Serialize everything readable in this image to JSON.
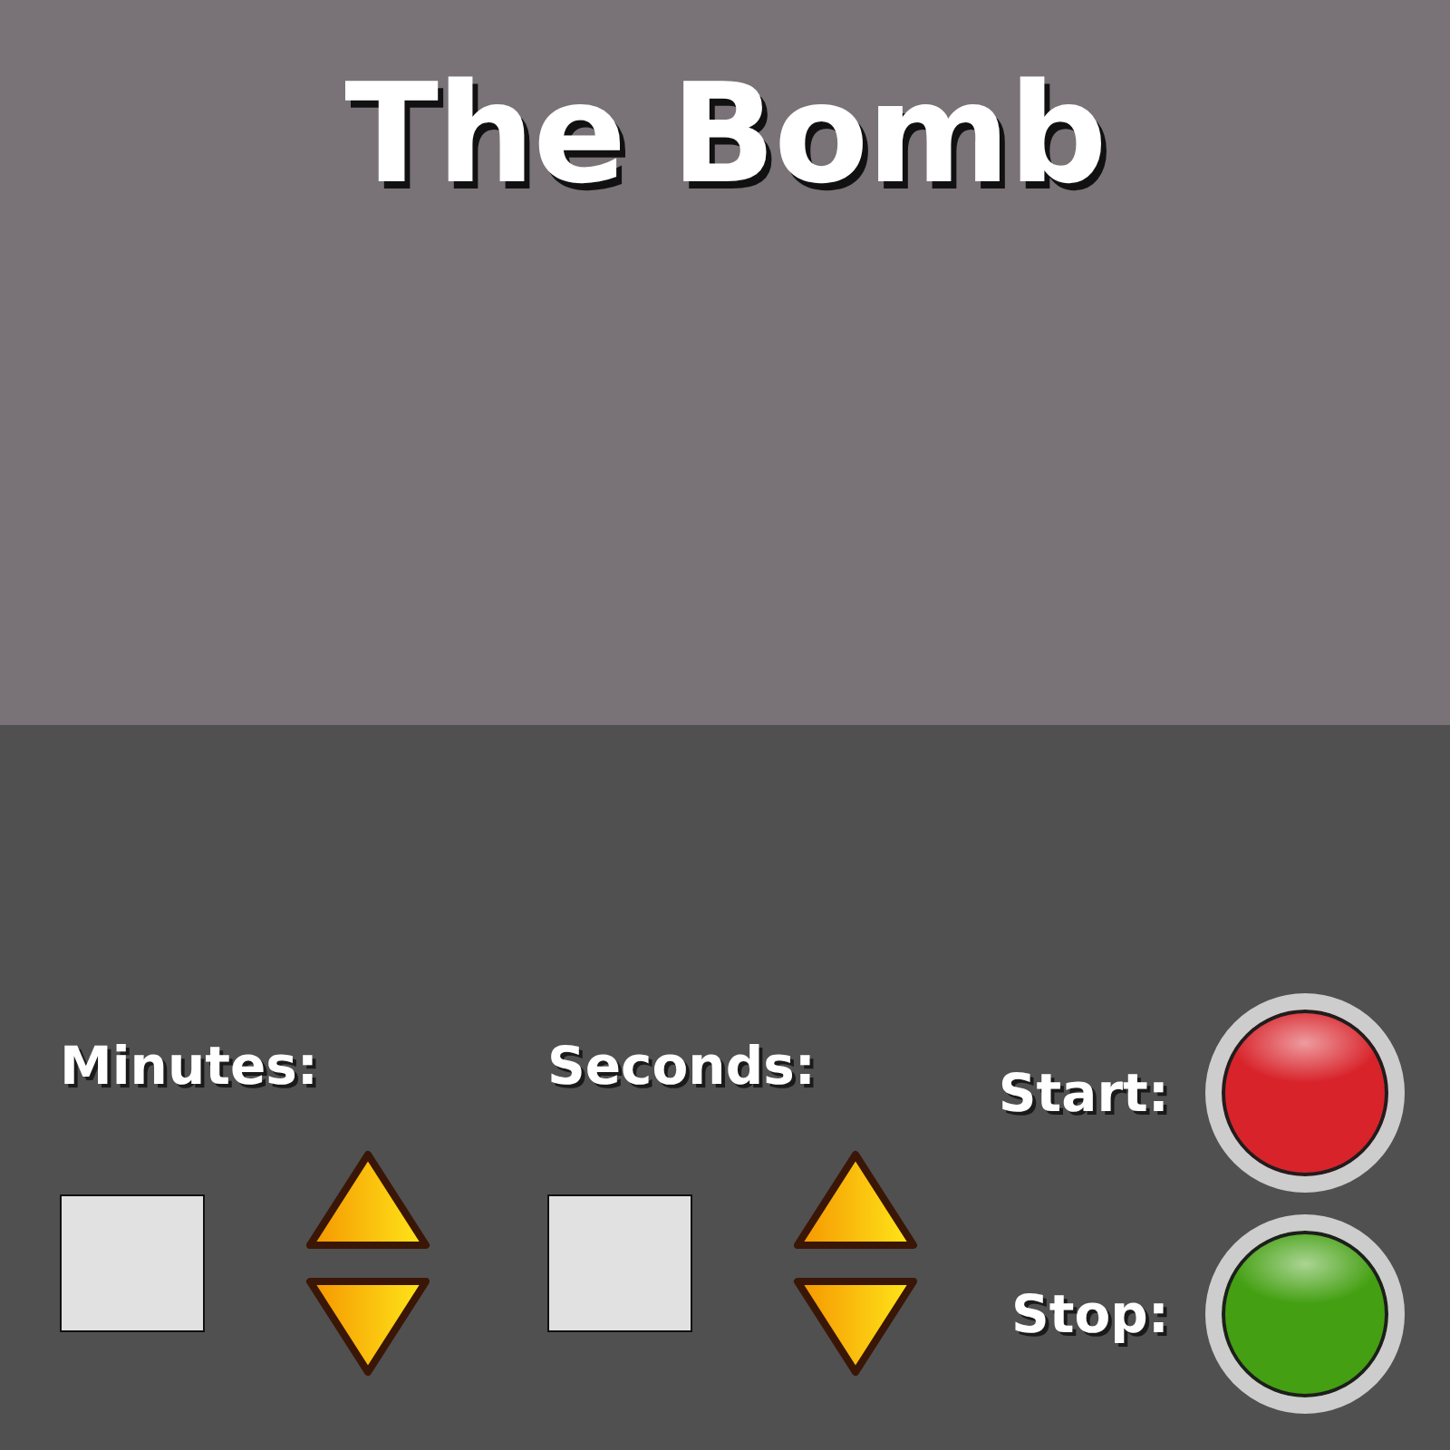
{
  "title": "The Bomb",
  "timer": [
    {
      "label": "Minutes:"
    },
    {
      "label": "Seconds:"
    }
  ],
  "buttons": [
    {
      "label": "Start:",
      "color": "#d8232a"
    },
    {
      "label": "Stop:",
      "color": "#44a012"
    }
  ]
}
